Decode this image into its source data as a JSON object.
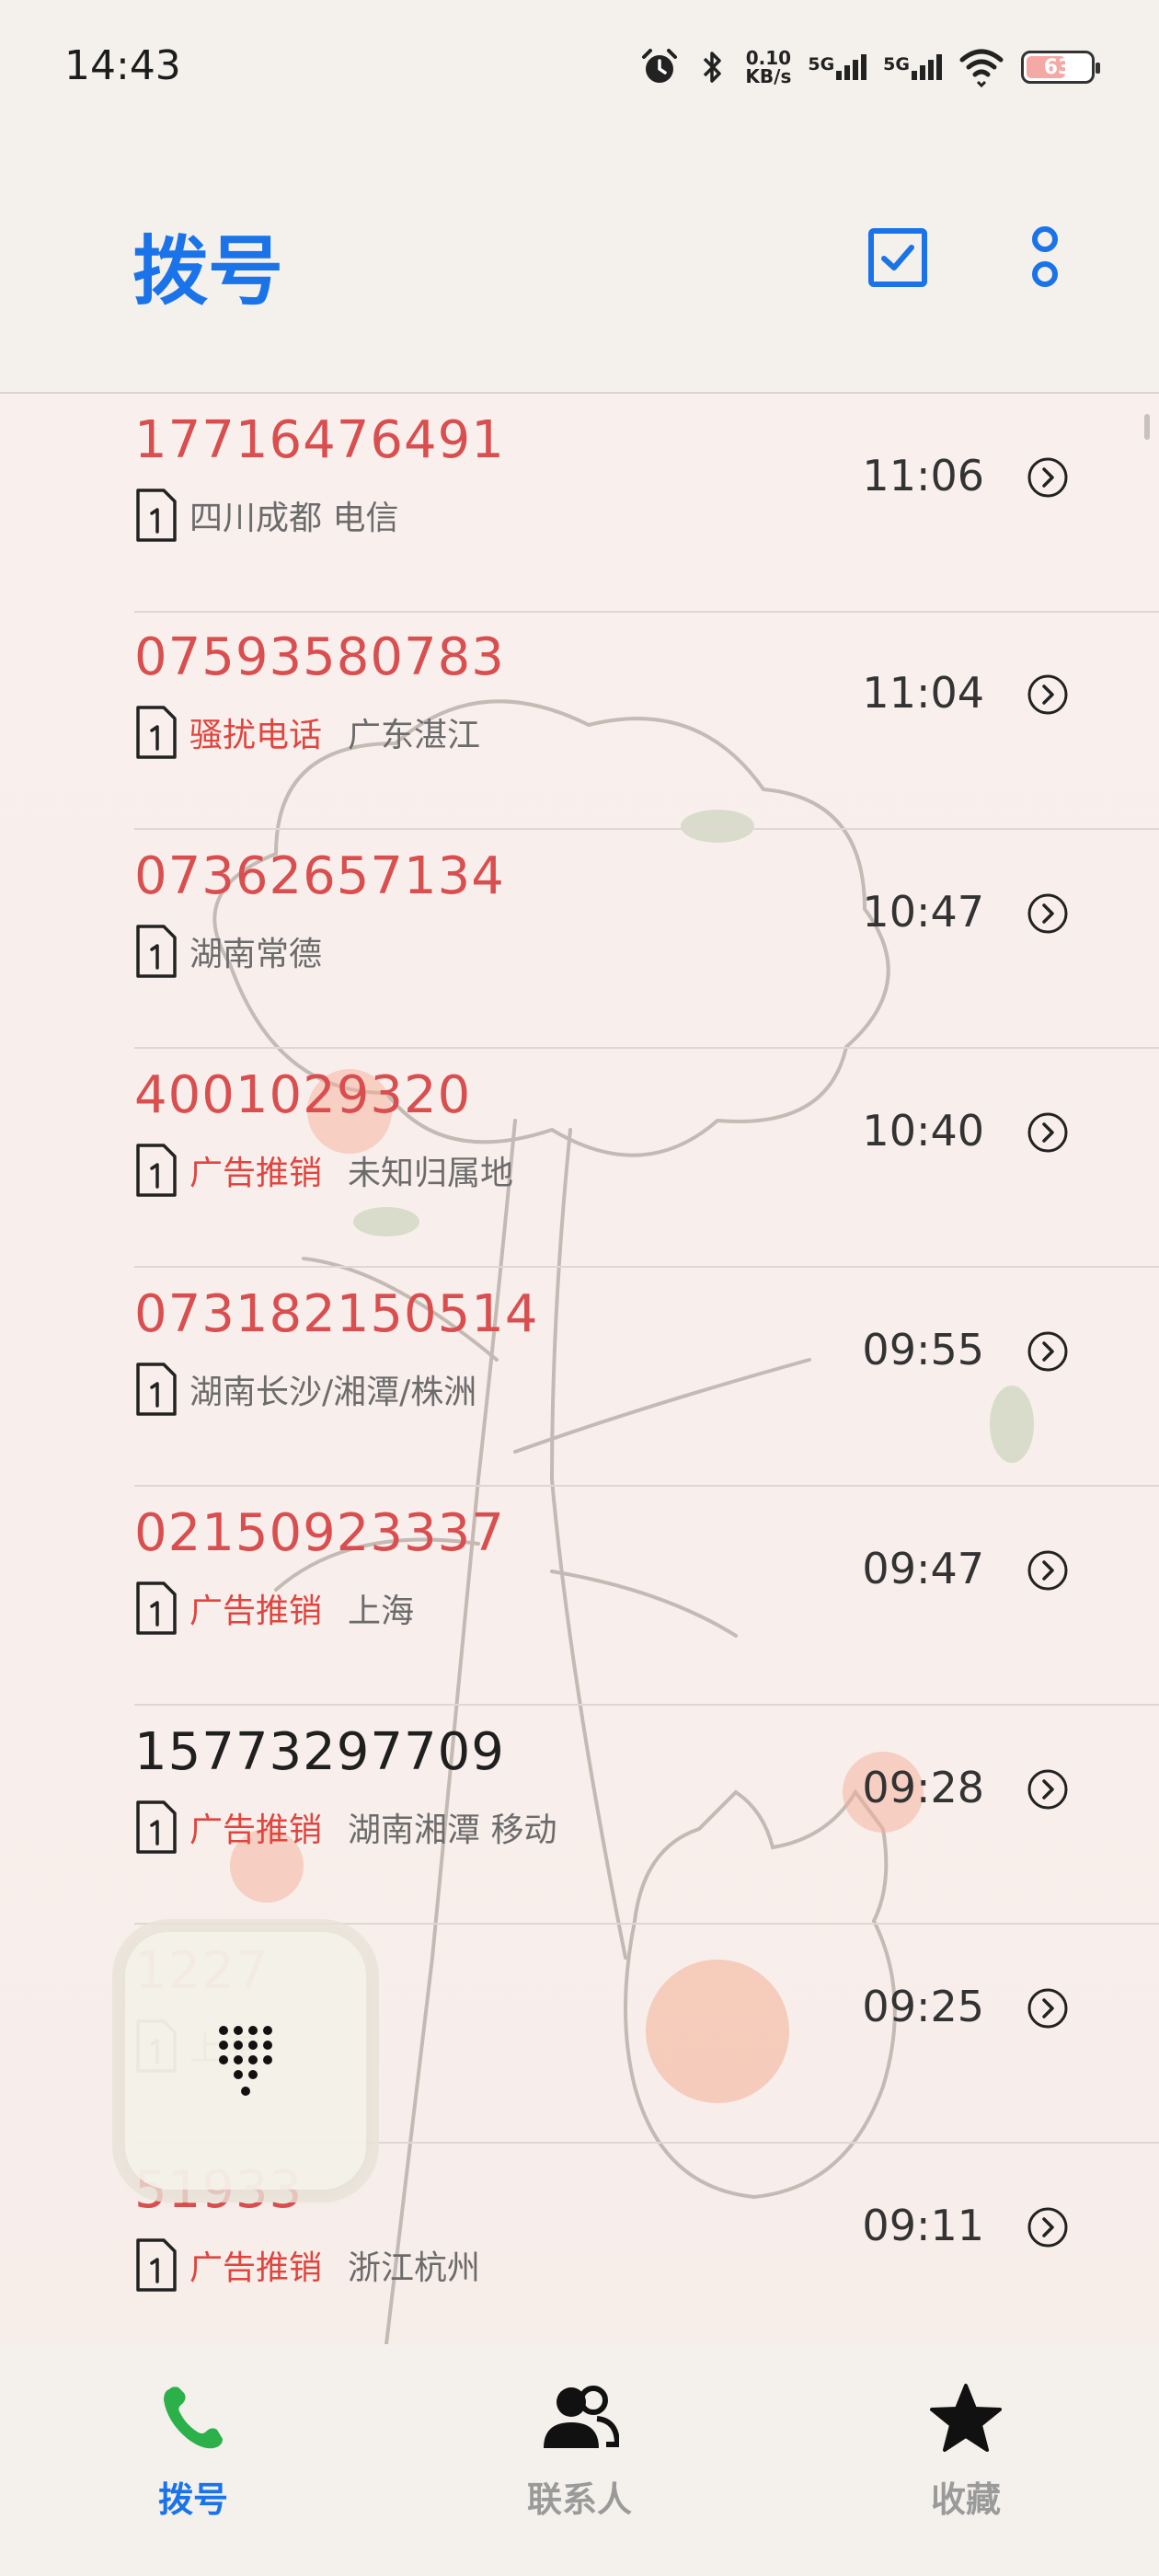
{
  "status_bar": {
    "time": "14:43",
    "speed_value": "0.10",
    "speed_unit": "KB/s",
    "sim1_label": "5G",
    "sim2_label": "5G",
    "battery_level": "63",
    "battery_color": "#f4a9a5"
  },
  "header": {
    "title": "拨号",
    "select_icon": "checkbox-icon",
    "more_icon": "more-vert-icon",
    "accent_color": "#1a73e8"
  },
  "calls": [
    {
      "number": "17716476491",
      "missed": true,
      "tag": "",
      "location": "四川成都  电信",
      "time": "11:06"
    },
    {
      "number": "07593580783",
      "missed": true,
      "tag": "骚扰电话",
      "location": "广东湛江",
      "time": "11:04"
    },
    {
      "number": "07362657134",
      "missed": true,
      "tag": "",
      "location": "湖南常德",
      "time": "10:47"
    },
    {
      "number": "4001029320",
      "missed": true,
      "tag": "广告推销",
      "location": "未知归属地",
      "time": "10:40"
    },
    {
      "number": "073182150514",
      "missed": true,
      "tag": "",
      "location": "湖南长沙/湘潭/株洲",
      "time": "09:55"
    },
    {
      "number": "02150923337",
      "missed": true,
      "tag": "广告推销",
      "location": "上海",
      "time": "09:47"
    },
    {
      "number": "15773297709",
      "missed": false,
      "tag": "广告推销",
      "location": "湖南湘潭  移动",
      "time": "09:28"
    },
    {
      "number": "1227",
      "missed": true,
      "tag": "",
      "location": "上海",
      "time": "09:25"
    },
    {
      "number": "51933",
      "missed": true,
      "tag": "广告推销",
      "location": "浙江杭州",
      "time": "09:11"
    }
  ],
  "colors": {
    "missed": "#d94f4f",
    "tag": "#e0453f"
  },
  "bottom_nav": [
    {
      "label": "拨号",
      "icon": "phone-icon",
      "active": true
    },
    {
      "label": "联系人",
      "icon": "contacts-icon",
      "active": false
    },
    {
      "label": "收藏",
      "icon": "star-icon",
      "active": false
    }
  ]
}
